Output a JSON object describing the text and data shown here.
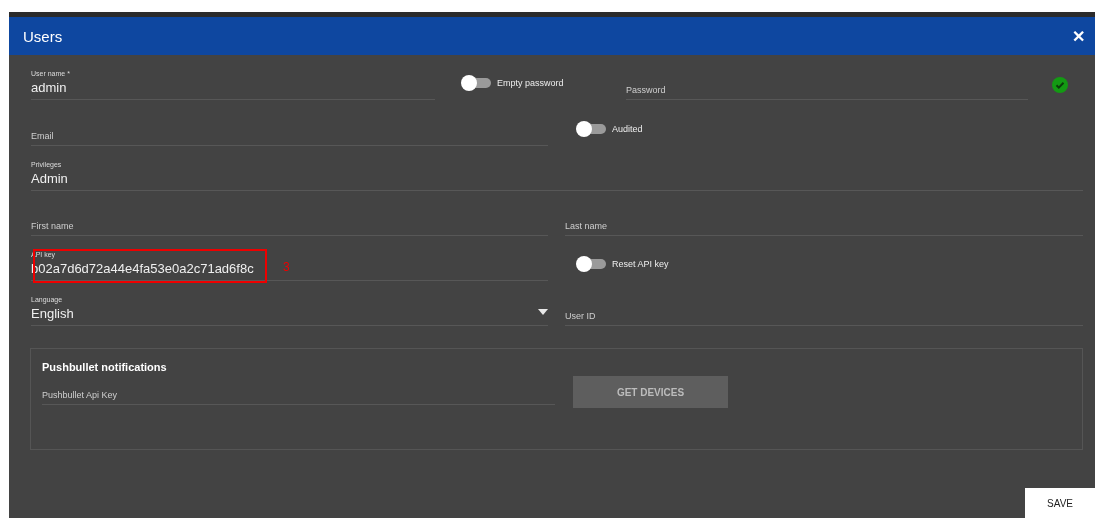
{
  "window": {
    "title": "Users",
    "close": "✕"
  },
  "user_name": {
    "label": "User name *",
    "value": "admin"
  },
  "empty_password": {
    "label": "Empty password",
    "on": false
  },
  "password": {
    "placeholder": "Password",
    "valid": true
  },
  "email": {
    "placeholder": "Email"
  },
  "audited": {
    "label": "Audited",
    "on": false
  },
  "privileges": {
    "label": "Privileges",
    "value": "Admin"
  },
  "first_name": {
    "placeholder": "First name"
  },
  "last_name": {
    "placeholder": "Last name"
  },
  "api_key": {
    "label": "API key",
    "value": "b02a7d6d72a44e4fa53e0a2c71ad6f8c",
    "annotation": "3"
  },
  "reset_api_key": {
    "label": "Reset API key",
    "on": false
  },
  "language": {
    "label": "Language",
    "value": "English"
  },
  "user_id": {
    "placeholder": "User ID"
  },
  "pushbullet": {
    "title": "Pushbullet notifications",
    "api_key": {
      "placeholder": "Pushbullet Api Key"
    },
    "button": {
      "label": "GET DEVICES",
      "disabled": true
    }
  },
  "save": "SAVE"
}
